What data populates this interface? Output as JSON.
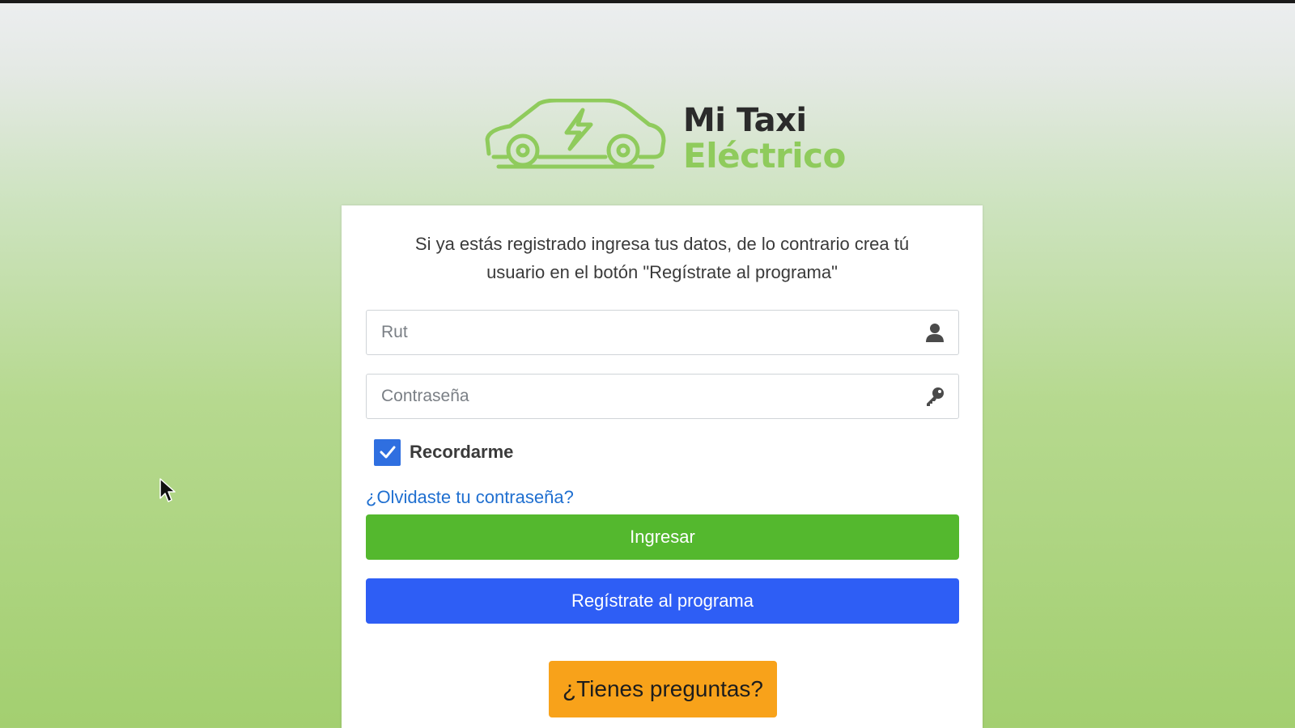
{
  "brand": {
    "name_line1": "Mi Taxi",
    "name_line2": "Eléctrico",
    "logo_icon": "electric-car-icon",
    "color_dark": "#2b2b2b",
    "color_green": "#8fcb5c"
  },
  "login": {
    "intro": "Si ya estás registrado ingresa tus datos, de lo contrario crea tú usuario en el botón \"Regístrate al programa\"",
    "rut": {
      "value": "",
      "placeholder": "Rut",
      "icon": "user-icon"
    },
    "password": {
      "value": "",
      "placeholder": "Contraseña",
      "icon": "key-icon"
    },
    "remember": {
      "label": "Recordarme",
      "checked": true
    },
    "forgot_link": "¿Olvidaste tu contraseña?",
    "submit_label": "Ingresar",
    "register_label": "Regístrate al programa",
    "help_label": "¿Tienes preguntas?"
  },
  "colors": {
    "submit": "#54b82e",
    "register": "#2e5ef5",
    "help": "#f8a21a",
    "link": "#1f6fd0",
    "checkbox": "#2f6fe0"
  }
}
